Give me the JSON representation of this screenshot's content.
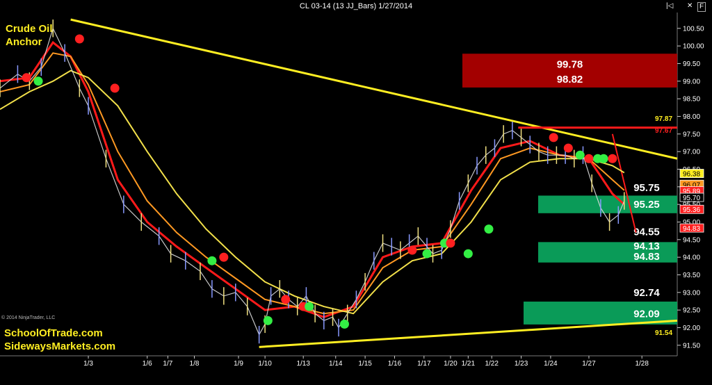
{
  "window": {
    "title": "CL 03-14 (13 JJ_Bars)  1/27/2014",
    "btn_nav": "|◁",
    "btn_close": "✕",
    "btn_f": "F"
  },
  "texts": {
    "top_left_title_1": "Crude Oil",
    "top_left_title_2": "Anchor",
    "copyright": "© 2014 NinjaTrader, LLC",
    "footer_1": "SchoolOfTrade.com",
    "footer_2": "SidewaysMarkets.com",
    "bottom_value": "91.54"
  },
  "colors": {
    "background": "#000000",
    "trendline": "#ffee22",
    "red_ma": "#ff1a1a",
    "orange_ma": "#ff9922",
    "yellow_ma": "#f2e04a",
    "zone_red": "#a30000",
    "zone_green": "#0a9b58",
    "dot_red": "#ff2020",
    "dot_green": "#33ee44"
  },
  "chart_data": {
    "type": "line",
    "y_axis": {
      "ylim": [
        91.2,
        100.95
      ],
      "ticks": [
        91.5,
        92.0,
        92.5,
        93.0,
        93.5,
        94.0,
        94.5,
        95.0,
        95.5,
        96.0,
        96.5,
        97.0,
        97.5,
        98.0,
        98.5,
        99.0,
        99.5,
        100.0,
        100.5
      ],
      "tick_labels": [
        "91.50",
        "92.00",
        "92.50",
        "93.00",
        "93.50",
        "94.00",
        "94.50",
        "95.00",
        "95.50",
        "96.00",
        "96.50",
        "97.00",
        "97.50",
        "98.00",
        "98.50",
        "99.00",
        "99.50",
        "100.00",
        "100.50"
      ]
    },
    "x_axis": {
      "labels": [
        "1/3",
        "1/6",
        "1/7",
        "1/8",
        "1/9",
        "1/10",
        "1/13",
        "1/14",
        "1/15",
        "1/16",
        "1/17",
        "1/20",
        "1/21",
        "1/22",
        "1/23",
        "1/24",
        "1/27",
        "1/28"
      ],
      "label_positions": [
        30,
        50,
        57,
        66,
        81,
        90,
        103,
        114,
        124,
        134,
        144,
        153,
        159,
        167,
        177,
        187,
        200,
        218
      ],
      "x_range": [
        0,
        230
      ]
    },
    "price_series": {
      "x": [
        0,
        6,
        10,
        14,
        18,
        22,
        27,
        30,
        36,
        42,
        48,
        54,
        58,
        63,
        68,
        72,
        76,
        80,
        84,
        88,
        90,
        92,
        95,
        98,
        101,
        104,
        107,
        110,
        113,
        115,
        118,
        121,
        124,
        127,
        130,
        133,
        136,
        139,
        142,
        145,
        147,
        150,
        153,
        156,
        159,
        162,
        165,
        168,
        171,
        174,
        177,
        180,
        183,
        186,
        189,
        192,
        195,
        198,
        201,
        204,
        207,
        210,
        212
      ],
      "values": [
        98.8,
        99.2,
        99.0,
        99.4,
        100.5,
        99.8,
        98.8,
        98.3,
        96.8,
        95.5,
        95.0,
        94.6,
        94.1,
        93.9,
        93.6,
        93.1,
        92.9,
        93.0,
        92.6,
        91.8,
        92.1,
        92.9,
        93.1,
        92.8,
        92.6,
        92.9,
        92.4,
        92.2,
        92.3,
        92.0,
        92.4,
        92.8,
        93.3,
        93.9,
        94.4,
        94.3,
        94.2,
        94.4,
        94.6,
        94.3,
        94.1,
        94.2,
        94.8,
        95.6,
        96.1,
        96.6,
        96.9,
        97.1,
        97.5,
        97.6,
        97.4,
        97.2,
        97.0,
        96.9,
        96.9,
        96.9,
        96.8,
        96.9,
        96.1,
        95.4,
        95.0,
        95.2,
        95.6
      ]
    },
    "moving_averages": [
      {
        "x": [
          0,
          10,
          18,
          24,
          30,
          40,
          50,
          60,
          70,
          80,
          90,
          100,
          110,
          120,
          130,
          140,
          150,
          160,
          170,
          180,
          190,
          200,
          208,
          212
        ],
        "values": [
          99.0,
          99.1,
          100.1,
          99.7,
          98.7,
          96.2,
          95.0,
          94.3,
          93.7,
          93.1,
          92.5,
          92.6,
          92.3,
          92.6,
          94.0,
          94.3,
          94.4,
          95.9,
          97.1,
          97.3,
          96.9,
          96.8,
          95.8,
          95.5
        ]
      },
      {
        "x": [
          0,
          10,
          18,
          24,
          30,
          40,
          50,
          60,
          70,
          80,
          90,
          100,
          110,
          120,
          130,
          140,
          150,
          160,
          170,
          180,
          190,
          200,
          208,
          212
        ],
        "values": [
          98.7,
          98.9,
          99.8,
          99.7,
          98.9,
          97.0,
          95.6,
          94.7,
          94.0,
          93.4,
          92.8,
          92.6,
          92.4,
          92.5,
          93.7,
          94.2,
          94.3,
          95.5,
          96.8,
          97.1,
          96.9,
          96.8,
          96.2,
          95.9
        ]
      },
      {
        "x": [
          0,
          10,
          18,
          24,
          30,
          40,
          50,
          60,
          70,
          80,
          90,
          100,
          110,
          120,
          130,
          140,
          150,
          160,
          170,
          180,
          190,
          200,
          208,
          212
        ],
        "values": [
          98.2,
          98.7,
          99.0,
          99.3,
          99.1,
          98.3,
          97.0,
          95.8,
          94.8,
          94.0,
          93.3,
          92.9,
          92.6,
          92.4,
          93.3,
          93.9,
          94.1,
          95.0,
          96.2,
          96.7,
          96.8,
          96.8,
          96.6,
          96.4
        ]
      }
    ],
    "trendlines": [
      {
        "x": [
          24,
          230
        ],
        "values": [
          100.75,
          96.8
        ]
      },
      {
        "x": [
          88,
          230
        ],
        "values": [
          91.45,
          92.2
        ]
      },
      {
        "x": [
          176,
          230
        ],
        "values": [
          97.68,
          97.68
        ]
      }
    ],
    "dots": [
      {
        "x": 9,
        "value": 99.1,
        "color": "red"
      },
      {
        "x": 13,
        "value": 99.0,
        "color": "green"
      },
      {
        "x": 27,
        "value": 100.2,
        "color": "red"
      },
      {
        "x": 39,
        "value": 98.8,
        "color": "red"
      },
      {
        "x": 72,
        "value": 93.9,
        "color": "green"
      },
      {
        "x": 76,
        "value": 94.0,
        "color": "red"
      },
      {
        "x": 91,
        "value": 92.2,
        "color": "green"
      },
      {
        "x": 97,
        "value": 92.8,
        "color": "red"
      },
      {
        "x": 103,
        "value": 92.6,
        "color": "red"
      },
      {
        "x": 105,
        "value": 92.6,
        "color": "green"
      },
      {
        "x": 117,
        "value": 92.1,
        "color": "green"
      },
      {
        "x": 140,
        "value": 94.2,
        "color": "red"
      },
      {
        "x": 145,
        "value": 94.1,
        "color": "green"
      },
      {
        "x": 151,
        "value": 94.4,
        "color": "green"
      },
      {
        "x": 153,
        "value": 94.4,
        "color": "red"
      },
      {
        "x": 159,
        "value": 94.1,
        "color": "green"
      },
      {
        "x": 166,
        "value": 94.8,
        "color": "green"
      },
      {
        "x": 188,
        "value": 97.4,
        "color": "red"
      },
      {
        "x": 193,
        "value": 97.1,
        "color": "red"
      },
      {
        "x": 197,
        "value": 96.9,
        "color": "green"
      },
      {
        "x": 200,
        "value": 96.8,
        "color": "red"
      },
      {
        "x": 203,
        "value": 96.8,
        "color": "green"
      },
      {
        "x": 205,
        "value": 96.8,
        "color": "green"
      },
      {
        "x": 208,
        "value": 96.8,
        "color": "red"
      }
    ],
    "zones": [
      {
        "color": "red",
        "top": 99.78,
        "bottom": 98.82,
        "labels": [
          "99.78",
          "98.82"
        ]
      },
      {
        "color": "green",
        "top": 95.75,
        "bottom": 95.25,
        "labels": [
          "95.75",
          "95.25"
        ]
      },
      {
        "color": "green",
        "top": 94.55,
        "bottom": 94.13,
        "labels": [
          "94.55",
          "94.13",
          "94.83"
        ]
      },
      {
        "color": "green",
        "top": 92.74,
        "bottom": 92.09,
        "labels": [
          "92.74",
          "92.09"
        ]
      }
    ],
    "price_tags": [
      {
        "value": 96.38,
        "label": "96.38",
        "bg": "#ffee22",
        "fg": "#000"
      },
      {
        "value": 96.07,
        "label": "96.07",
        "bg": "#ff9922",
        "fg": "#000"
      },
      {
        "value": 95.89,
        "label": "95.89",
        "bg": "#ff2020",
        "fg": "#fff"
      },
      {
        "value": 95.7,
        "label": "95.70",
        "bg": "#000000",
        "fg": "#fff"
      },
      {
        "value": 95.36,
        "label": "95.36",
        "bg": "#ff2020",
        "fg": "#fff"
      },
      {
        "value": 94.83,
        "label": "94.83",
        "bg": "#ff2020",
        "fg": "#fff"
      }
    ],
    "axis_annotations": [
      {
        "value": 97.87,
        "label": "97.87",
        "color": "#ffee22"
      },
      {
        "value": 97.67,
        "label": "97.67",
        "color": "#ff2020"
      }
    ]
  }
}
